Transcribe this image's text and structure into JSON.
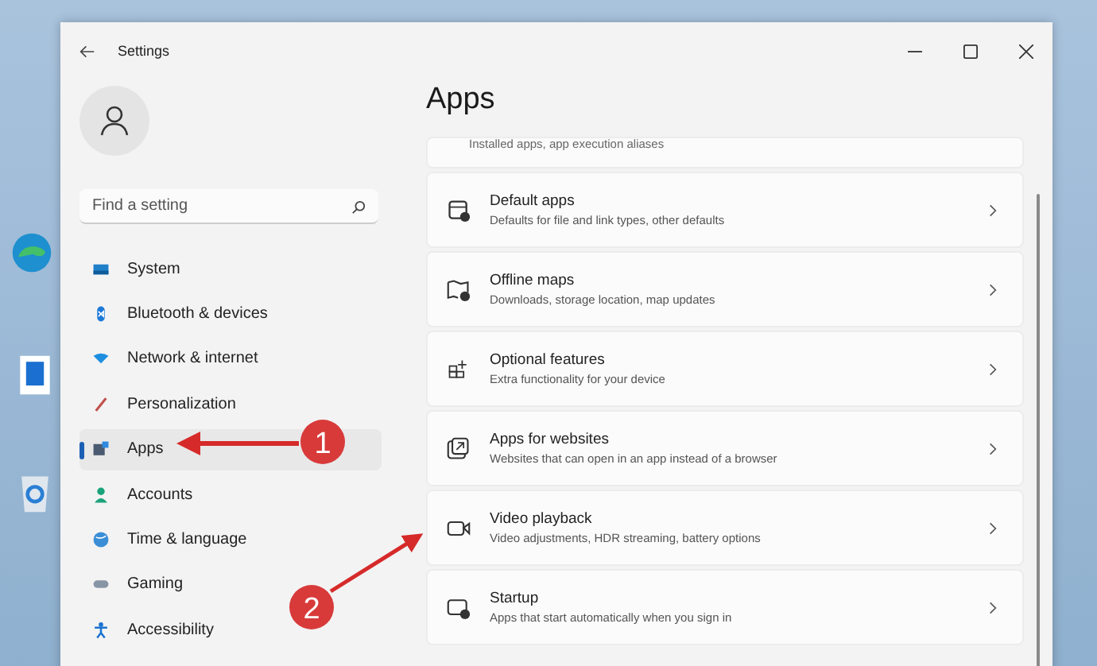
{
  "window": {
    "title": "Settings"
  },
  "search": {
    "placeholder": "Find a setting"
  },
  "sidebar": {
    "items": [
      {
        "label": "System",
        "selected": false
      },
      {
        "label": "Bluetooth & devices",
        "selected": false
      },
      {
        "label": "Network & internet",
        "selected": false
      },
      {
        "label": "Personalization",
        "selected": false
      },
      {
        "label": "Apps",
        "selected": true
      },
      {
        "label": "Accounts",
        "selected": false
      },
      {
        "label": "Time & language",
        "selected": false
      },
      {
        "label": "Gaming",
        "selected": false
      },
      {
        "label": "Accessibility",
        "selected": false
      }
    ]
  },
  "page": {
    "title": "Apps",
    "partial_description": "Installed apps, app execution aliases",
    "cards": [
      {
        "title": "Default apps",
        "description": "Defaults for file and link types, other defaults"
      },
      {
        "title": "Offline maps",
        "description": "Downloads, storage location, map updates"
      },
      {
        "title": "Optional features",
        "description": "Extra functionality for your device"
      },
      {
        "title": "Apps for websites",
        "description": "Websites that can open in an app instead of a browser"
      },
      {
        "title": "Video playback",
        "description": "Video adjustments, HDR streaming, battery options"
      },
      {
        "title": "Startup",
        "description": "Apps that start automatically when you sign in"
      }
    ]
  },
  "annotations": [
    {
      "label": "1"
    },
    {
      "label": "2"
    }
  ]
}
